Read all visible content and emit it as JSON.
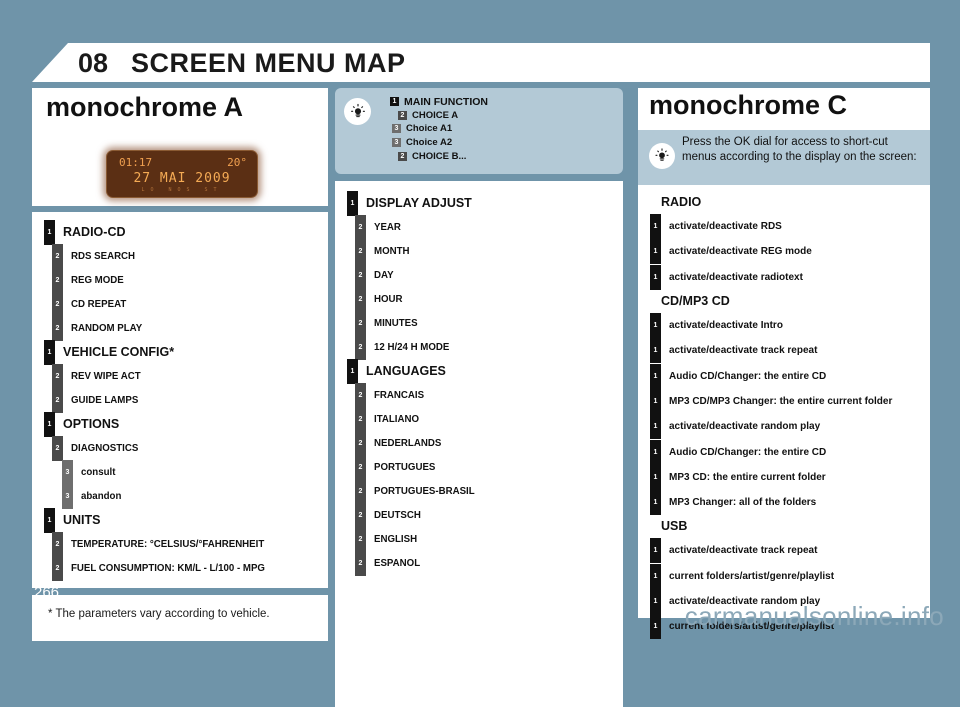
{
  "header": {
    "chapter_number": "08",
    "title": "SCREEN MENU MAP"
  },
  "left": {
    "heading": "monochrome A",
    "display": {
      "icon": "lcd-display",
      "clock": "01:17",
      "temperature": "20°",
      "date": "27 MAI 2009",
      "status_line": "LO      NOS   ST"
    },
    "items": [
      {
        "level": 1,
        "badge": "1",
        "label": "RADIO-CD"
      },
      {
        "level": 2,
        "badge": "2",
        "label": "RDS SEARCH"
      },
      {
        "level": 2,
        "badge": "2",
        "label": "REG MODE"
      },
      {
        "level": 2,
        "badge": "2",
        "label": "CD REPEAT"
      },
      {
        "level": 2,
        "badge": "2",
        "label": "RANDOM PLAY"
      },
      {
        "level": 1,
        "badge": "1",
        "label": "VEHICLE CONFIG*"
      },
      {
        "level": 2,
        "badge": "2",
        "label": "REV WIPE ACT"
      },
      {
        "level": 2,
        "badge": "2",
        "label": "GUIDE LAMPS"
      },
      {
        "level": 1,
        "badge": "1",
        "label": "OPTIONS"
      },
      {
        "level": 2,
        "badge": "2",
        "label": "DIAGNOSTICS"
      },
      {
        "level": 3,
        "badge": "3",
        "label": "consult"
      },
      {
        "level": 3,
        "badge": "3",
        "label": "abandon"
      },
      {
        "level": 1,
        "badge": "1",
        "label": "UNITS"
      },
      {
        "level": 2,
        "badge": "2",
        "label": "TEMPERATURE: °CELSIUS/°FAHRENHEIT"
      },
      {
        "level": 2,
        "badge": "2",
        "label": "FUEL CONSUMPTION: KM/L - L/100 - MPG"
      }
    ],
    "footnote": "* The parameters vary according to vehicle."
  },
  "middle": {
    "legend": {
      "icon": "bulb-icon",
      "lines": [
        {
          "level": 1,
          "badge": "1",
          "label": "MAIN FUNCTION"
        },
        {
          "level": 2,
          "badge": "2",
          "label": "CHOICE A"
        },
        {
          "level": 3,
          "badge": "3",
          "label": "Choice A1"
        },
        {
          "level": 3,
          "badge": "3",
          "label": "Choice A2"
        },
        {
          "level": 2,
          "badge": "2",
          "label": "CHOICE B..."
        }
      ]
    },
    "items": [
      {
        "level": 1,
        "badge": "1",
        "label": "DISPLAY ADJUST"
      },
      {
        "level": 2,
        "badge": "2",
        "label": "YEAR"
      },
      {
        "level": 2,
        "badge": "2",
        "label": "MONTH"
      },
      {
        "level": 2,
        "badge": "2",
        "label": "DAY"
      },
      {
        "level": 2,
        "badge": "2",
        "label": "HOUR"
      },
      {
        "level": 2,
        "badge": "2",
        "label": "MINUTES"
      },
      {
        "level": 2,
        "badge": "2",
        "label": "12 H/24 H MODE"
      },
      {
        "level": 1,
        "badge": "1",
        "label": "LANGUAGES"
      },
      {
        "level": 2,
        "badge": "2",
        "label": "FRANCAIS"
      },
      {
        "level": 2,
        "badge": "2",
        "label": "ITALIANO"
      },
      {
        "level": 2,
        "badge": "2",
        "label": "NEDERLANDS"
      },
      {
        "level": 2,
        "badge": "2",
        "label": "PORTUGUES"
      },
      {
        "level": 2,
        "badge": "2",
        "label": "PORTUGUES-BRASIL"
      },
      {
        "level": 2,
        "badge": "2",
        "label": "DEUTSCH"
      },
      {
        "level": 2,
        "badge": "2",
        "label": "ENGLISH"
      },
      {
        "level": 2,
        "badge": "2",
        "label": "ESPANOL"
      }
    ]
  },
  "right": {
    "heading": "monochrome C",
    "intro": {
      "icon": "bulb-icon",
      "text": "Press the OK dial for access to short-cut menus according to the display on the screen:"
    },
    "items": [
      {
        "type": "group",
        "label": "RADIO"
      },
      {
        "type": "item",
        "badge": "1",
        "label": "activate/deactivate RDS"
      },
      {
        "type": "item",
        "badge": "1",
        "label": "activate/deactivate REG mode"
      },
      {
        "type": "item",
        "badge": "1",
        "label": "activate/deactivate radiotext"
      },
      {
        "type": "group",
        "label": "CD/MP3 CD"
      },
      {
        "type": "item",
        "badge": "1",
        "label": "activate/deactivate Intro"
      },
      {
        "type": "item",
        "badge": "1",
        "label": "activate/deactivate track repeat"
      },
      {
        "type": "item",
        "badge": "1",
        "label": "Audio CD/Changer: the entire CD"
      },
      {
        "type": "item",
        "badge": "1",
        "label": "MP3 CD/MP3 Changer: the entire current folder"
      },
      {
        "type": "item",
        "badge": "1",
        "label": "activate/deactivate random play"
      },
      {
        "type": "item",
        "badge": "1",
        "label": "Audio CD/Changer: the entire CD"
      },
      {
        "type": "item",
        "badge": "1",
        "label": "MP3 CD: the entire current folder"
      },
      {
        "type": "item",
        "badge": "1",
        "label": "MP3 Changer: all of the folders"
      },
      {
        "type": "group",
        "label": "USB"
      },
      {
        "type": "item",
        "badge": "1",
        "label": "activate/deactivate track repeat"
      },
      {
        "type": "item",
        "badge": "1",
        "label": "current folders/artist/genre/playlist"
      },
      {
        "type": "item",
        "badge": "1",
        "label": "activate/deactivate random play"
      },
      {
        "type": "item",
        "badge": "1",
        "label": "current folders/artist/genre/playlist"
      }
    ]
  },
  "footer": {
    "page_number": "266",
    "watermark": "carmanualsonline.info"
  },
  "colors": {
    "background": "#6f94a9",
    "panel": "#ffffff",
    "legend_panel": "#b3c9d6",
    "badge_level1": "#111111",
    "badge_level2": "#4a4a4a",
    "badge_level3": "#6e6e6e",
    "lcd_background": "#5b2f14",
    "lcd_text": "#f0a050",
    "watermark": "#8ca8b8"
  }
}
